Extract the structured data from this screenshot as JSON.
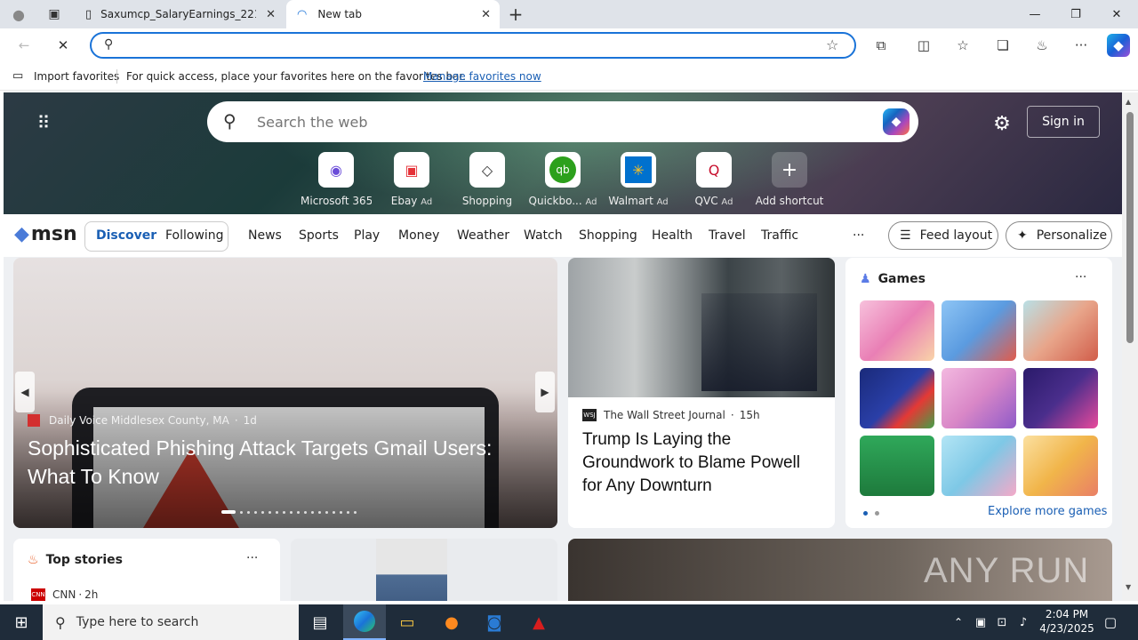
{
  "browser": {
    "tabs": [
      {
        "title": "Saxumcp_SalaryEarnings_221505..."
      },
      {
        "title": "New tab"
      }
    ],
    "new_tab": "+",
    "window": {
      "minimize": "—",
      "restore": "❐",
      "close": "✕"
    },
    "address_placeholder": ""
  },
  "favorites_bar": {
    "import_label": "Import favorites",
    "message": "For quick access, place your favorites here on the favorites bar.",
    "manage_link": "Manage favorites now"
  },
  "msn": {
    "search_placeholder": "Search the web",
    "sign_in": "Sign in",
    "shortcuts": [
      {
        "label": "Microsoft 365",
        "ad": ""
      },
      {
        "label": "Ebay",
        "ad": "Ad"
      },
      {
        "label": "Shopping",
        "ad": ""
      },
      {
        "label": "Quickbo...",
        "ad": "Ad"
      },
      {
        "label": "Walmart",
        "ad": "Ad"
      },
      {
        "label": "QVC",
        "ad": "Ad"
      },
      {
        "label": "Add shortcut",
        "ad": ""
      }
    ],
    "logo": "msn",
    "toggle": {
      "discover": "Discover",
      "following": "Following"
    },
    "nav": [
      "News",
      "Sports",
      "Play",
      "Money",
      "Weather",
      "Watch",
      "Shopping",
      "Health",
      "Travel",
      "Traffic"
    ],
    "more": "···",
    "feed_layout": "Feed layout",
    "personalize": "Personalize",
    "main_story": {
      "source": "Daily Voice Middlesex County, MA",
      "age": "1d",
      "headline": "Sophisticated Phishing Attack Targets Gmail Users: What To Know"
    },
    "wsj_story": {
      "source": "The Wall Street Journal",
      "age": "15h",
      "headline": "Trump Is Laying the Groundwork to Blame Powell for Any Downturn"
    },
    "games": {
      "title": "Games",
      "more": "···",
      "explore": "Explore more games",
      "tiles": [
        {
          "name": "dressup",
          "color": "#e97fb5"
        },
        {
          "name": "restaurant",
          "color": "#5b9be0"
        },
        {
          "name": "hospital",
          "color": "#e8a58a"
        },
        {
          "name": "blocks",
          "color": "#2a3fa8"
        },
        {
          "name": "makeup",
          "color": "#d987c7"
        },
        {
          "name": "bubble-shooter",
          "color": "#4a2e8c"
        },
        {
          "name": "solitaire",
          "color": "#1e7a3c"
        },
        {
          "name": "nail-salon",
          "color": "#7ec8e6"
        },
        {
          "name": "cupcake",
          "color": "#f1b54a"
        }
      ]
    },
    "top_stories": {
      "title": "Top stories",
      "more": "···",
      "source": "CNN",
      "age": "2h"
    }
  },
  "taskbar": {
    "search_placeholder": "Type here to search",
    "time": "2:04 PM",
    "date": "4/23/2025"
  },
  "watermark": "ANY RUN"
}
